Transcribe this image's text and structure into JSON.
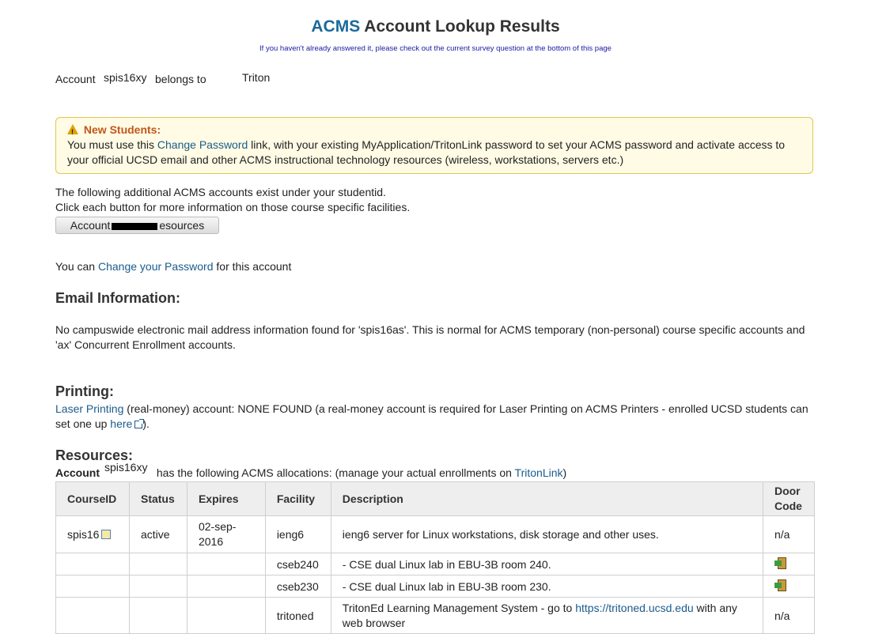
{
  "header": {
    "brand": "ACMS",
    "title_rest": " Account Lookup Results",
    "survey_note": "If you haven't already answered it, please check out the current survey question at the bottom of this page"
  },
  "account_line": {
    "label": "Account",
    "account": "spis16xy",
    "belongs": "belongs to",
    "owner": "Triton"
  },
  "notice": {
    "title": "New Students:",
    "text_before": "You must use this ",
    "link": "Change Password",
    "text_after": " link, with your existing MyApplication/TritonLink password to set your ACMS password and activate access to your official UCSD email and other ACMS instructional technology resources (wireless, workstations, servers etc.)"
  },
  "additional": {
    "line1": "The following additional ACMS accounts exist under your studentid.",
    "line2": "Click each button for more information on those course specific facilities.",
    "button_left": "Account",
    "button_right": "esources"
  },
  "password": {
    "before": "You can ",
    "link": "Change your Password",
    "after": " for this account"
  },
  "email": {
    "heading": "Email Information:",
    "text": "No campuswide electronic mail address information found for 'spis16as'. This is normal for ACMS temporary (non-personal) course specific accounts and 'ax' Concurrent Enrollment accounts."
  },
  "printing": {
    "heading": "Printing:",
    "link": "Laser Printing",
    "text": " (real-money) account: NONE FOUND (a real-money account is required for Laser Printing on ACMS Printers - enrolled UCSD students can set one up ",
    "here": "here",
    "end": ")."
  },
  "resources": {
    "heading": "Resources:",
    "acct_label": "Account",
    "acct_overlay": "spis16xy",
    "text": " has the following ACMS allocations: (manage your actual enrollments on ",
    "link": "TritonLink",
    "end": ")"
  },
  "table": {
    "headers": [
      "CourseID",
      "Status",
      "Expires",
      "Facility",
      "Description",
      "Door Code"
    ],
    "rows": [
      {
        "course": "spis16",
        "status": "active",
        "expires": "02-sep-2016",
        "facility": "ieng6",
        "description": "ieng6 server for Linux workstations, disk storage and other uses.",
        "door": "n/a"
      },
      {
        "course": "",
        "status": "",
        "expires": "",
        "facility": "cseb240",
        "description": "- CSE dual Linux lab in EBU-3B room 240.",
        "door": "door-icon"
      },
      {
        "course": "",
        "status": "",
        "expires": "",
        "facility": "cseb230",
        "description": "- CSE dual Linux lab in EBU-3B room 230.",
        "door": "door-icon"
      },
      {
        "course": "",
        "status": "",
        "expires": "",
        "facility": "tritoned",
        "description_before": "TritonEd Learning Management System - go to ",
        "description_link": "https://tritoned.ucsd.edu",
        "description_after": " with any web browser",
        "door": "n/a"
      }
    ]
  }
}
